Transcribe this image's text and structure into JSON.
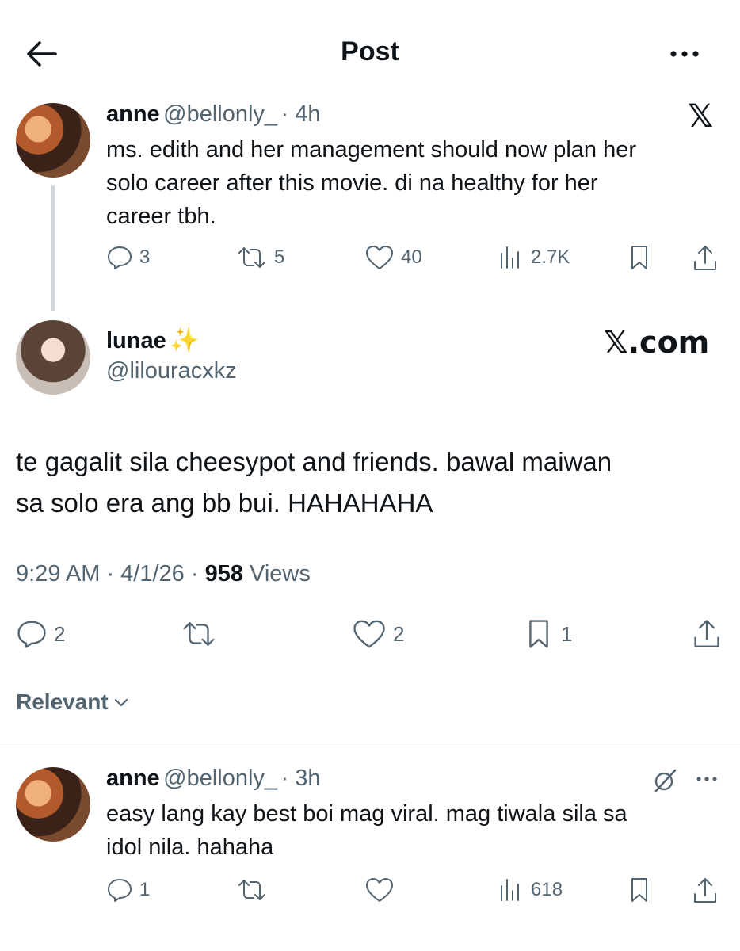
{
  "header": {
    "title": "Post"
  },
  "parent_post": {
    "name": "anne",
    "handle": "@bellonly_",
    "time": "· 4h",
    "text_lines": [
      "ms. edith and her management should now plan her",
      "solo career after this movie. di na healthy for her",
      "career tbh."
    ],
    "replies": "3",
    "reposts": "5",
    "likes": "40",
    "views": "2.7K",
    "source_logo": "𝕏"
  },
  "main_post": {
    "name": "lunae",
    "emoji": "✨",
    "handle": "@lilouracxkz",
    "watermark": "𝕏.com",
    "text_lines": [
      "te gagalit sila cheesypot and friends. bawal maiwan",
      "sa solo era ang bb bui. HAHAHAHA"
    ],
    "time": "9:29 AM · 4/1/26 · ",
    "views_count": "958",
    "views_label": " Views",
    "replies": "2",
    "likes": "2",
    "bookmarks": "1"
  },
  "sort": {
    "label": "Relevant"
  },
  "reply_post": {
    "name": "anne",
    "handle": "@bellonly_",
    "time": "· 3h",
    "text_lines": [
      "easy lang kay best boi mag viral. mag tiwala sila sa",
      "idol nila. hahaha"
    ],
    "replies": "1",
    "views": "618"
  }
}
